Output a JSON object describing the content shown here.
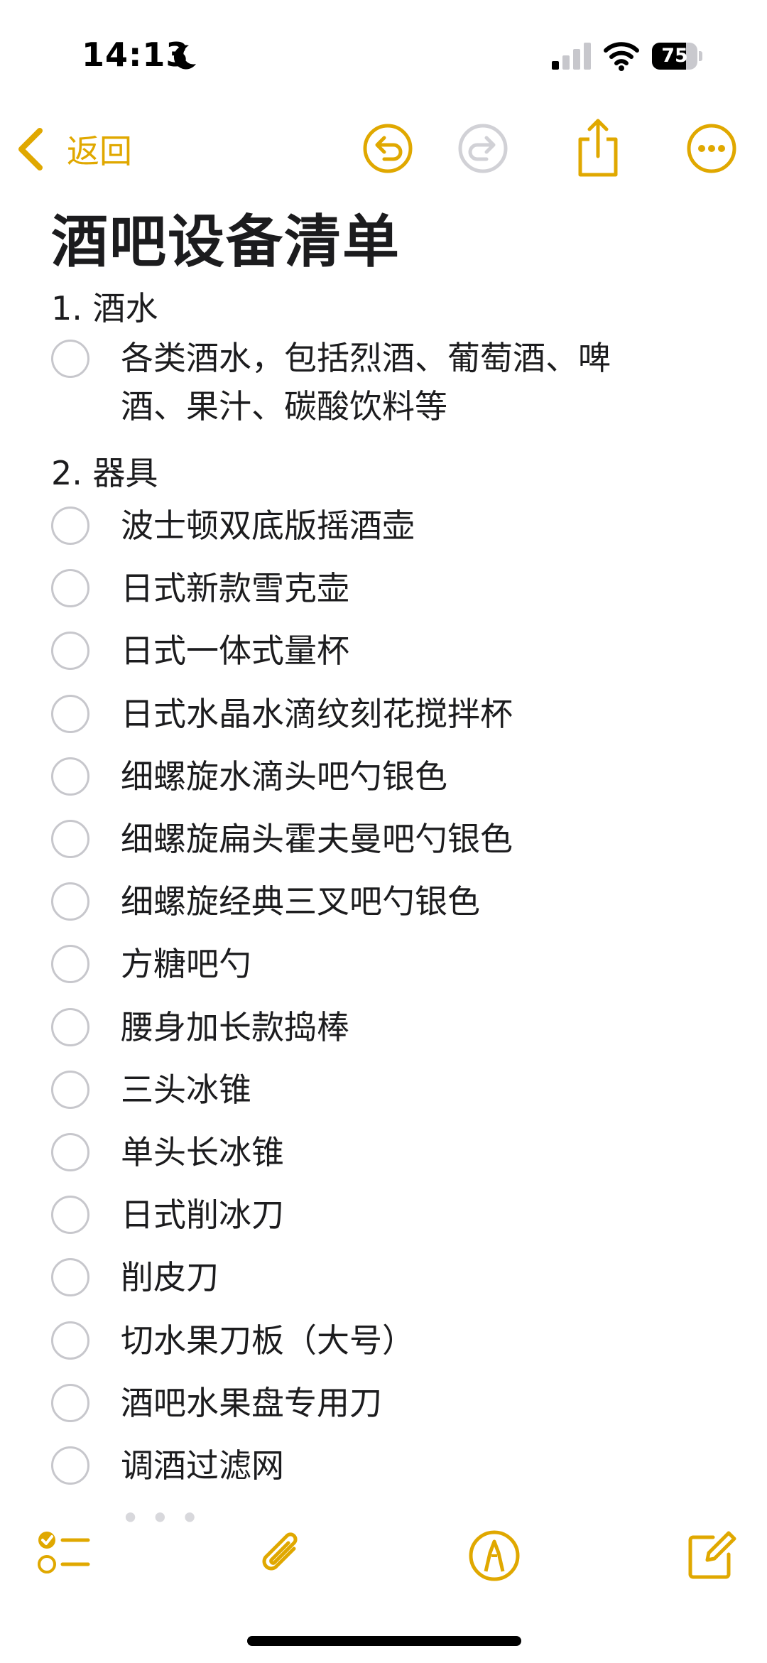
{
  "status_bar": {
    "time": "14:13",
    "battery": "75",
    "battery_level": 0.75
  },
  "nav": {
    "back_label": "返回",
    "icons": [
      "undo-icon",
      "redo-icon",
      "share-icon",
      "more-icon"
    ]
  },
  "note": {
    "title": "酒吧设备清单",
    "sections": [
      {
        "heading": "1. 酒水",
        "items": [
          {
            "line1": "各类酒水，包括烈酒、葡萄酒、啤",
            "line2": "酒、果汁、碳酸饮料等",
            "checked": false
          }
        ]
      },
      {
        "heading": "2. 器具",
        "items": [
          {
            "text": "波士顿双底版摇酒壶",
            "checked": false
          },
          {
            "text": "日式新款雪克壶",
            "checked": false
          },
          {
            "text": "日式一体式量杯",
            "checked": false
          },
          {
            "text": "日式水晶水滴纹刻花搅拌杯",
            "checked": false
          },
          {
            "text": "细螺旋水滴头吧勺银色",
            "checked": false
          },
          {
            "text": "细螺旋扁头霍夫曼吧勺银色",
            "checked": false
          },
          {
            "text": "细螺旋经典三叉吧勺银色",
            "checked": false
          },
          {
            "text": "方糖吧勺",
            "checked": false
          },
          {
            "text": "腰身加长款捣棒",
            "checked": false
          },
          {
            "text": "三头冰锥",
            "checked": false
          },
          {
            "text": "单头长冰锥",
            "checked": false
          },
          {
            "text": "日式削冰刀",
            "checked": false
          },
          {
            "text": "削皮刀",
            "checked": false
          },
          {
            "text": "切水果刀板（大号）",
            "checked": false
          },
          {
            "text": "酒吧水果盘专用刀",
            "checked": false
          },
          {
            "text": "调酒过滤网",
            "checked": false
          }
        ]
      }
    ]
  },
  "toolbar": {
    "icons": [
      "checklist-icon",
      "attachment-icon",
      "markup-icon",
      "compose-icon"
    ]
  },
  "colors": {
    "accent": "#e0a800",
    "text": "#1c1c1e",
    "checkbox": "#c7c7cc"
  }
}
